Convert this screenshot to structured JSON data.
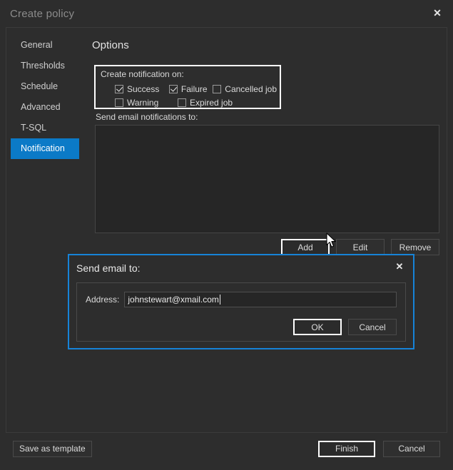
{
  "window": {
    "title": "Create policy",
    "close_icon": "close-icon",
    "close_glyph": "✕"
  },
  "sidebar": {
    "items": [
      {
        "label": "General",
        "selected": false
      },
      {
        "label": "Thresholds",
        "selected": false
      },
      {
        "label": "Schedule",
        "selected": false
      },
      {
        "label": "Advanced",
        "selected": false
      },
      {
        "label": "T-SQL",
        "selected": false
      },
      {
        "label": "Notification",
        "selected": true
      }
    ]
  },
  "content": {
    "heading": "Options",
    "notification_group": {
      "legend": "Create notification on:",
      "checkboxes": [
        {
          "label": "Success",
          "checked": true
        },
        {
          "label": "Failure",
          "checked": true
        },
        {
          "label": "Cancelled job",
          "checked": false
        },
        {
          "label": "Warning",
          "checked": false
        },
        {
          "label": "Expired job",
          "checked": false
        }
      ]
    },
    "email_list_label": "Send email notifications to:",
    "email_list_items": [],
    "list_buttons": {
      "add": "Add",
      "edit": "Edit",
      "remove": "Remove"
    }
  },
  "subdialog": {
    "title": "Send email to:",
    "close_glyph": "✕",
    "address_label": "Address:",
    "address_value": "johnstewart@xmail.com",
    "address_placeholder": "",
    "ok": "OK",
    "cancel": "Cancel"
  },
  "footer": {
    "save_as_template": "Save as template",
    "finish": "Finish",
    "cancel": "Cancel"
  },
  "colors": {
    "accent_blue": "#0b7ac7",
    "dialog_border_blue": "#1683d8",
    "window_bg": "#2d2d2d",
    "focus_white": "#ffffff"
  }
}
